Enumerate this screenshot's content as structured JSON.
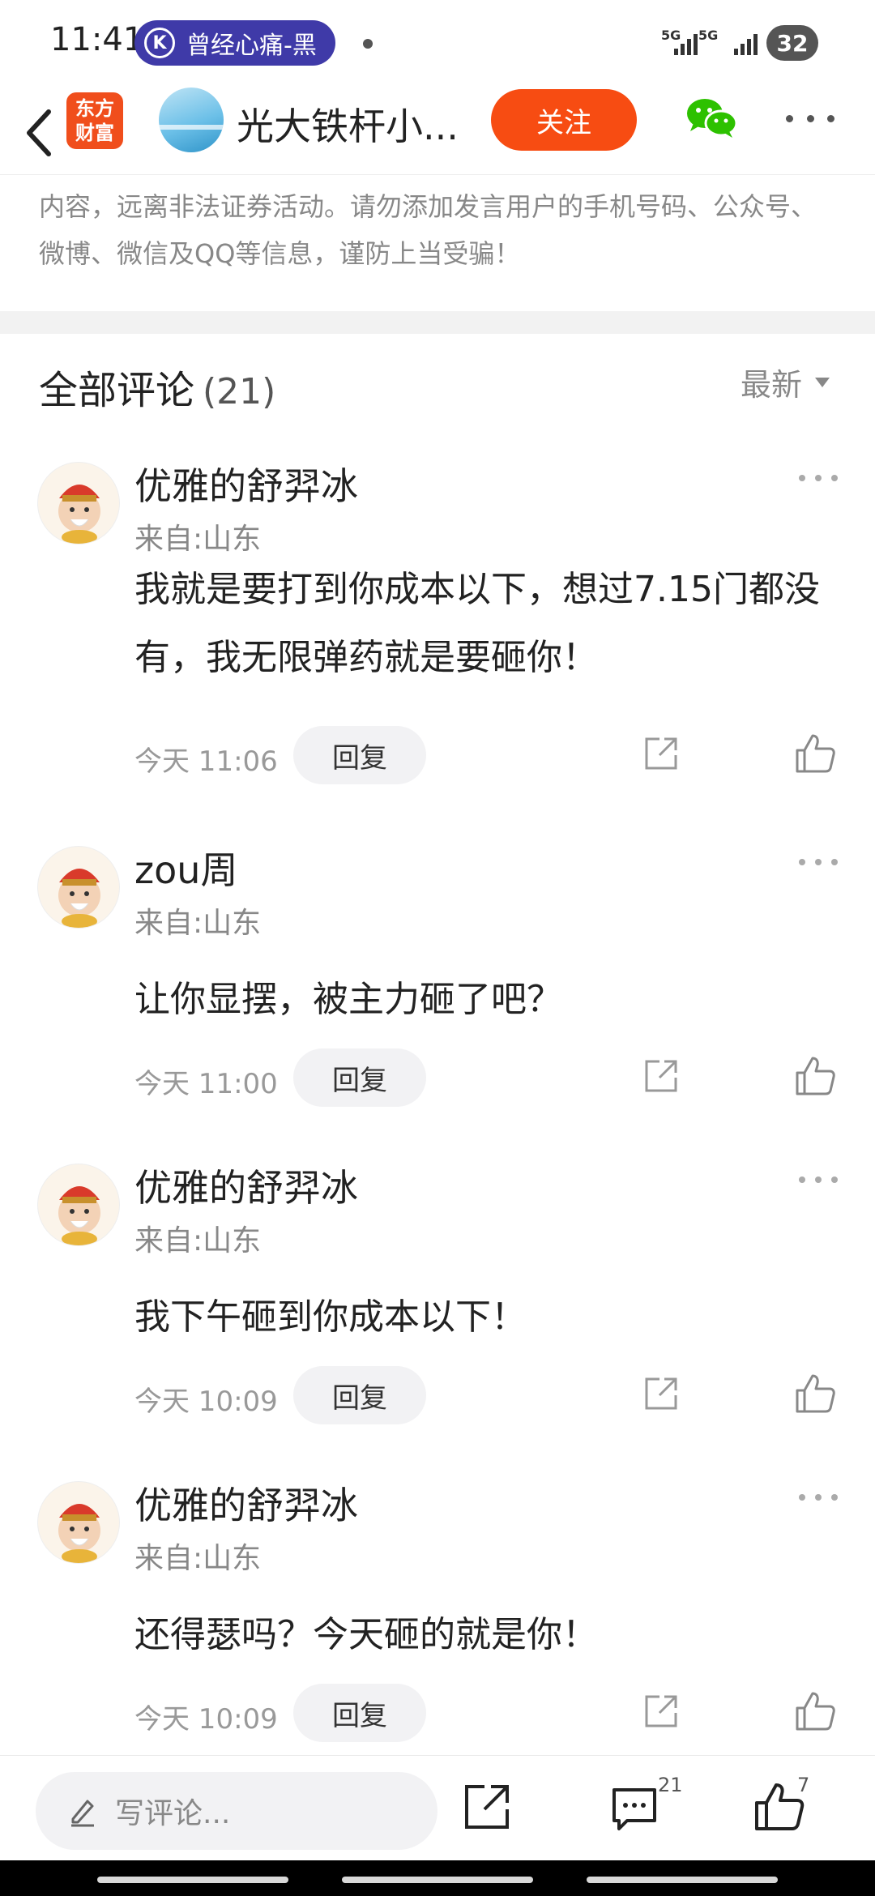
{
  "status_bar": {
    "time": "11:41",
    "music": {
      "badge": "K",
      "title": "曾经心痛-黑"
    },
    "signal_1": "5G",
    "signal_2": "5G",
    "battery": "32"
  },
  "nav": {
    "app_logo": "东方财富",
    "channel_title": "光大铁杆小...",
    "follow_label": "关注"
  },
  "notice": {
    "text": "内容，远离非法证券活动。请勿添加发言用户的手机号码、公众号、微博、微信及QQ等信息，谨防上当受骗！"
  },
  "comments_header": {
    "title": "全部评论",
    "count": "(21)",
    "sort_label": "最新"
  },
  "comments": [
    {
      "name": "优雅的舒羿冰",
      "location": "来自:山东",
      "text": "我就是要打到你成本以下，想过7.15门都没有，我无限弹药就是要砸你！",
      "time": "今天 11:06",
      "reply_label": "回复"
    },
    {
      "name": "zou周",
      "location": "来自:山东",
      "text": "让你显摆，被主力砸了吧？",
      "time": "今天 11:00",
      "reply_label": "回复"
    },
    {
      "name": "优雅的舒羿冰",
      "location": "来自:山东",
      "text": "我下午砸到你成本以下！",
      "time": "今天 10:09",
      "reply_label": "回复"
    },
    {
      "name": "优雅的舒羿冰",
      "location": "来自:山东",
      "text": "还得瑟吗？今天砸的就是你！",
      "time": "今天 10:09",
      "reply_label": "回复"
    }
  ],
  "bottom_bar": {
    "input_placeholder": "写评论...",
    "comment_count": "21",
    "like_count": "7"
  },
  "colors": {
    "accent": "#f74c12",
    "music_pill": "#3f3aa8",
    "wechat": "#2dc100"
  },
  "icons": [
    "back-arrow-icon",
    "wechat-icon",
    "more-icon",
    "share-icon",
    "like-icon",
    "comment-icon",
    "pencil-icon"
  ]
}
